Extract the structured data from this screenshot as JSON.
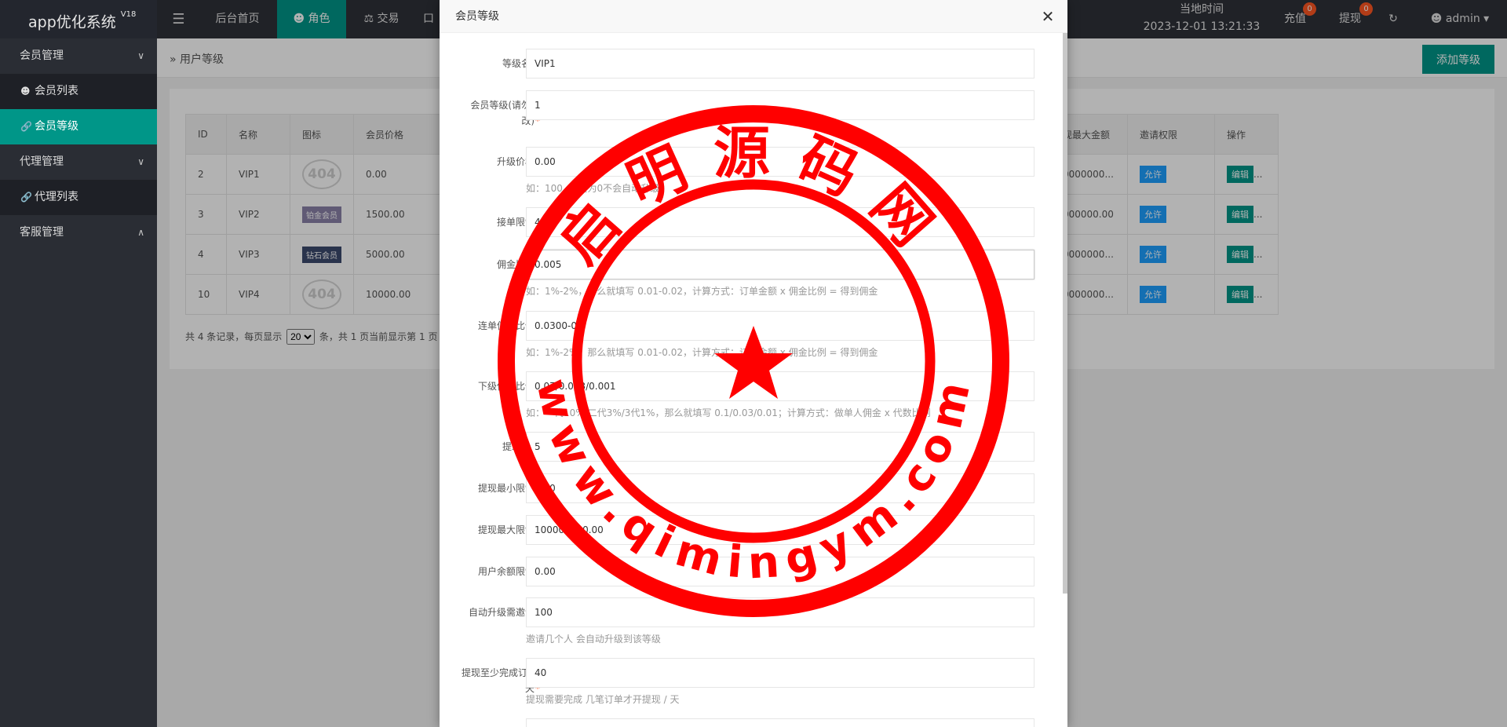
{
  "app": {
    "title": "app优化系统",
    "version": "V18"
  },
  "sidebar": {
    "groups": [
      {
        "label": "会员管理",
        "items": [
          {
            "label": "会员列表"
          },
          {
            "label": "会员等级"
          }
        ]
      },
      {
        "label": "代理管理",
        "items": [
          {
            "label": "代理列表"
          }
        ]
      },
      {
        "label": "客服管理",
        "items": []
      }
    ]
  },
  "topbar": {
    "menu_toggle_icon": "menu-icon",
    "tabs": [
      "后台首页",
      "角色",
      "交易",
      "口"
    ],
    "clock_label": "当地时间",
    "clock_value": "2023-12-01 13:21:33",
    "recharge_label": "充值",
    "recharge_count": "0",
    "withdraw_label": "提现",
    "withdraw_count": "0",
    "user": "admin"
  },
  "breadcrumb": "用户等级",
  "add_button": "添加等级",
  "table": {
    "headers": [
      "ID",
      "名称",
      "图标",
      "会员价格",
      "现最大金额",
      "邀请权限",
      "操作"
    ],
    "rows": [
      {
        "id": "2",
        "name": "VIP1",
        "icon": "404",
        "price": "0.00",
        "max": "0000000...",
        "invite": "允许",
        "edit": "编辑",
        "more": "..."
      },
      {
        "id": "3",
        "name": "VIP2",
        "icon": "铂金会员",
        "price": "1500.00",
        "max": "000000.00",
        "invite": "允许",
        "edit": "编辑",
        "more": "..."
      },
      {
        "id": "4",
        "name": "VIP3",
        "icon": "钻石会员",
        "price": "5000.00",
        "max": "0000000...",
        "invite": "允许",
        "edit": "编辑",
        "more": "..."
      },
      {
        "id": "10",
        "name": "VIP4",
        "icon": "404",
        "price": "10000.00",
        "max": "0000000...",
        "invite": "允许",
        "edit": "编辑",
        "more": "..."
      }
    ],
    "pager_before": "共 4 条记录，每页显示",
    "page_size": "20",
    "pager_after": "条，共 1 页当前显示第 1 页"
  },
  "modal": {
    "title": "会员等级",
    "fields": [
      {
        "label": "等级名称",
        "required": false,
        "value": "VIP1"
      },
      {
        "label": "会员等级(请勿修改)",
        "required": true,
        "value": "1"
      },
      {
        "label": "升级价格",
        "required": true,
        "value": "0.00",
        "hint": "如：100, 设置为0不会自动升级"
      },
      {
        "label": "接单限制",
        "required": true,
        "value": "40"
      },
      {
        "label": "佣金比例",
        "required": true,
        "value": "0.005",
        "hint": "如：1%-2%，那么就填写 0.01-0.02，计算方式：订单金额 x 佣金比例 = 得到佣金"
      },
      {
        "label": "连单佣金比例",
        "required": true,
        "value": "0.0300-0.0",
        "hint": "如：1%-2%，那么就填写 0.01-0.02，计算方式：订单金额 x 佣金比例 = 得到佣金"
      },
      {
        "label": "下级佣金比例",
        "required": true,
        "value": "0.07/0.003/0.001",
        "hint": "如：一代10%/二代3%/3代1%，那么就填写 0.1/0.03/0.01；计算方式：做单人佣金 x 代数比例"
      },
      {
        "label": "提现次数",
        "required": false,
        "value": "5"
      },
      {
        "label": "提现最小限制",
        "required": true,
        "value": "0.00"
      },
      {
        "label": "提现最大限制",
        "required": true,
        "value": "100000000.00"
      },
      {
        "label": "用户余额限制",
        "required": true,
        "value": "0.00"
      },
      {
        "label": "自动升级需邀请",
        "required": true,
        "value": "100",
        "hint": "邀请几个人 会自动升级到该等级"
      },
      {
        "label": "提现至少完成订单/天",
        "required": true,
        "value": "40",
        "hint": "提现需要完成 几笔订单才开提现 / 天"
      }
    ]
  },
  "watermark": {
    "top_text": "启明源码网",
    "bottom_text": "www.qimingym.com"
  },
  "colors": {
    "accent": "#009688",
    "seal": "#ff0000",
    "blue": "#1e9fff",
    "badge": "#ff5722"
  }
}
